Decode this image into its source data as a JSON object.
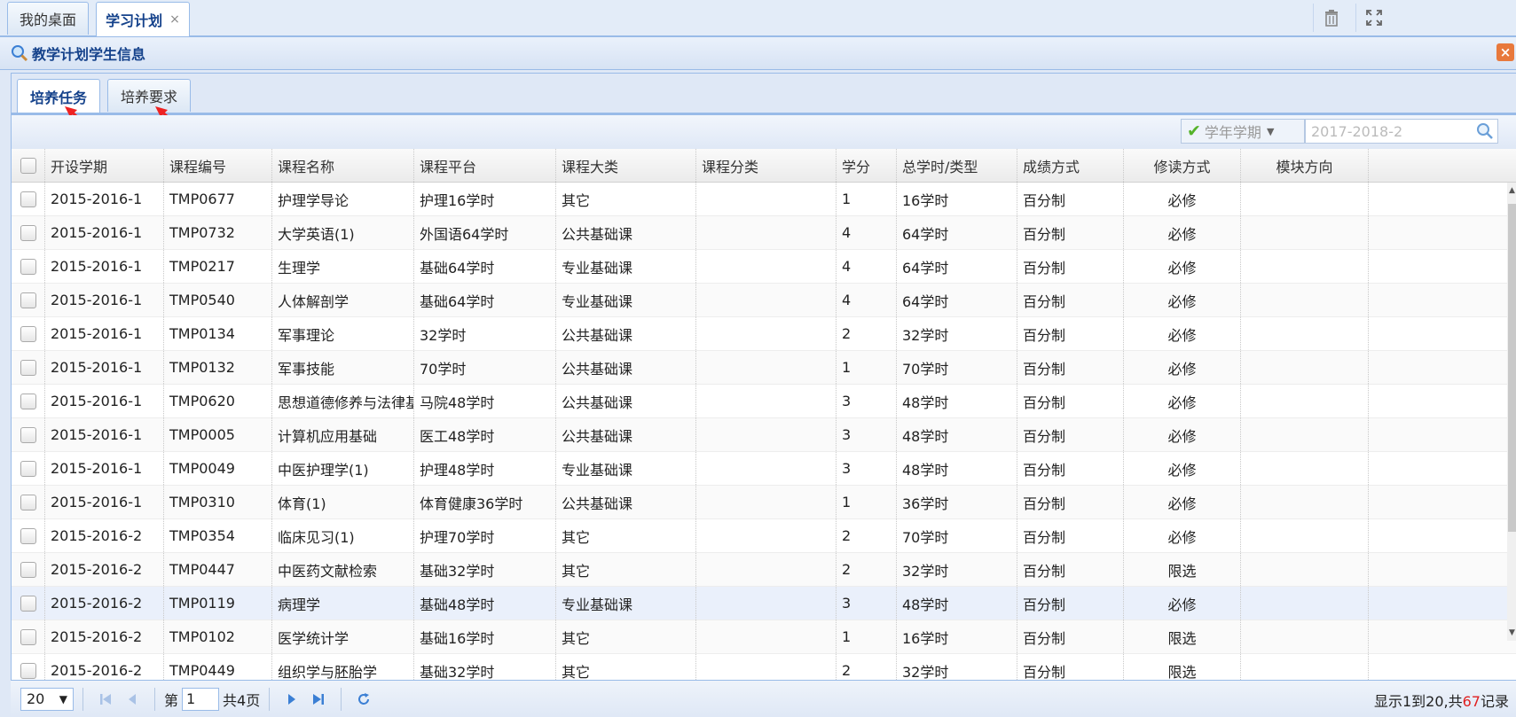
{
  "top_tabs": [
    {
      "label": "我的桌面"
    },
    {
      "label": "学习计划",
      "close": "×"
    }
  ],
  "panel": {
    "title": "教学计划学生信息"
  },
  "inner_tabs": [
    {
      "label": "培养任务"
    },
    {
      "label": "培养要求"
    }
  ],
  "filter": {
    "combo_label": "学年学期",
    "search_value": "2017-2018-2"
  },
  "columns": [
    "开设学期",
    "课程编号",
    "课程名称",
    "课程平台",
    "课程大类",
    "课程分类",
    "学分",
    "总学时/类型",
    "成绩方式",
    "修读方式",
    "模块方向"
  ],
  "rows": [
    [
      "2015-2016-1",
      "TMP0677",
      "护理学导论",
      "护理16学时",
      "其它",
      "",
      "1",
      "16学时",
      "百分制",
      "必修",
      ""
    ],
    [
      "2015-2016-1",
      "TMP0732",
      "大学英语(1)",
      "外国语64学时",
      "公共基础课",
      "",
      "4",
      "64学时",
      "百分制",
      "必修",
      ""
    ],
    [
      "2015-2016-1",
      "TMP0217",
      "生理学",
      "基础64学时",
      "专业基础课",
      "",
      "4",
      "64学时",
      "百分制",
      "必修",
      ""
    ],
    [
      "2015-2016-1",
      "TMP0540",
      "人体解剖学",
      "基础64学时",
      "专业基础课",
      "",
      "4",
      "64学时",
      "百分制",
      "必修",
      ""
    ],
    [
      "2015-2016-1",
      "TMP0134",
      "军事理论",
      "32学时",
      "公共基础课",
      "",
      "2",
      "32学时",
      "百分制",
      "必修",
      ""
    ],
    [
      "2015-2016-1",
      "TMP0132",
      "军事技能",
      "70学时",
      "公共基础课",
      "",
      "1",
      "70学时",
      "百分制",
      "必修",
      ""
    ],
    [
      "2015-2016-1",
      "TMP0620",
      "思想道德修养与法律基",
      "马院48学时",
      "公共基础课",
      "",
      "3",
      "48学时",
      "百分制",
      "必修",
      ""
    ],
    [
      "2015-2016-1",
      "TMP0005",
      "计算机应用基础",
      "医工48学时",
      "公共基础课",
      "",
      "3",
      "48学时",
      "百分制",
      "必修",
      ""
    ],
    [
      "2015-2016-1",
      "TMP0049",
      "中医护理学(1)",
      "护理48学时",
      "专业基础课",
      "",
      "3",
      "48学时",
      "百分制",
      "必修",
      ""
    ],
    [
      "2015-2016-1",
      "TMP0310",
      "体育(1)",
      "体育健康36学时",
      "公共基础课",
      "",
      "1",
      "36学时",
      "百分制",
      "必修",
      ""
    ],
    [
      "2015-2016-2",
      "TMP0354",
      "临床见习(1)",
      "护理70学时",
      "其它",
      "",
      "2",
      "70学时",
      "百分制",
      "必修",
      ""
    ],
    [
      "2015-2016-2",
      "TMP0447",
      "中医药文献检索",
      "基础32学时",
      "其它",
      "",
      "2",
      "32学时",
      "百分制",
      "限选",
      ""
    ],
    [
      "2015-2016-2",
      "TMP0119",
      "病理学",
      "基础48学时",
      "专业基础课",
      "",
      "3",
      "48学时",
      "百分制",
      "必修",
      ""
    ],
    [
      "2015-2016-2",
      "TMP0102",
      "医学统计学",
      "基础16学时",
      "其它",
      "",
      "1",
      "16学时",
      "百分制",
      "限选",
      ""
    ],
    [
      "2015-2016-2",
      "TMP0449",
      "组织学与胚胎学",
      "基础32学时",
      "其它",
      "",
      "2",
      "32学时",
      "百分制",
      "限选",
      ""
    ]
  ],
  "selected_row": 12,
  "pager": {
    "page_size": "20",
    "page_prefix": "第",
    "page_value": "1",
    "page_suffix": "共4页",
    "info_prefix": "显示1到20,共",
    "info_total": "67",
    "info_suffix": "记录"
  },
  "colors": {
    "accent": "#15428b",
    "border": "#99bbe8",
    "highlight": "#e02020"
  }
}
